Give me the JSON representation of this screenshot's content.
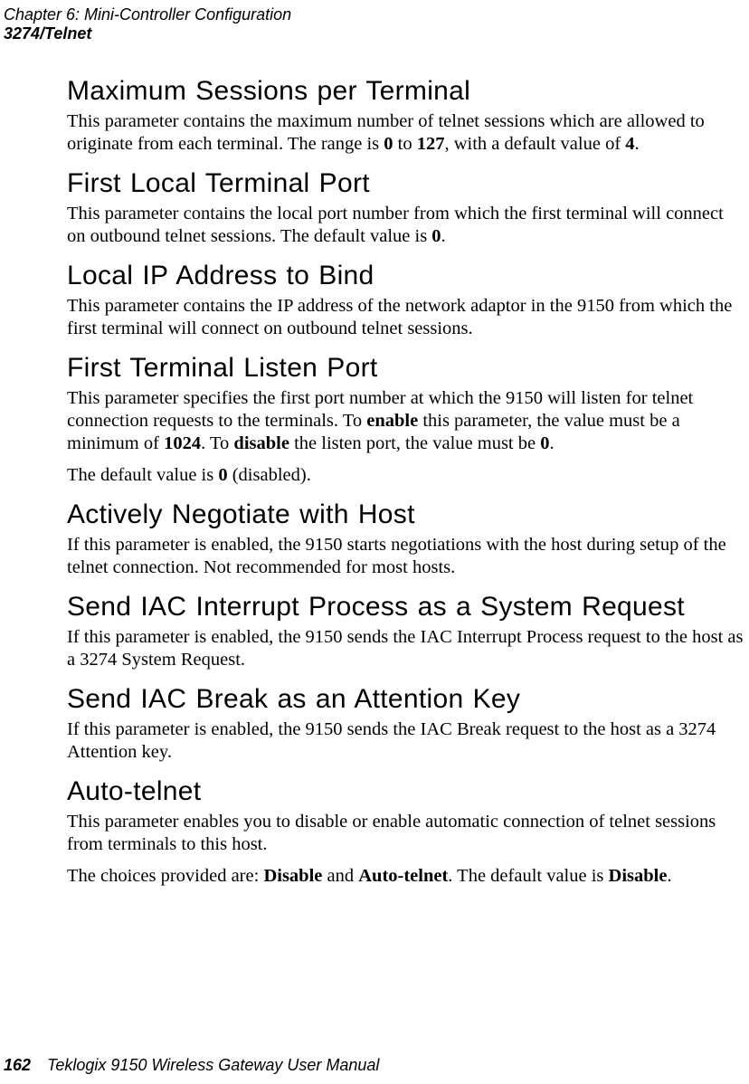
{
  "header": {
    "chapter": "Chapter 6:  Mini-Controller Configuration",
    "section": "3274/Telnet"
  },
  "sections": {
    "s1": {
      "title": "Maximum Sessions per Terminal",
      "p1a": "This parameter contains the maximum number of telnet sessions which are allowed to originate from each terminal. The range is ",
      "p1b": "0",
      "p1c": " to ",
      "p1d": "127",
      "p1e": ", with a default value of ",
      "p1f": "4",
      "p1g": "."
    },
    "s2": {
      "title": "First Local Terminal Port",
      "p1a": "This parameter contains the local port number from which the first terminal will connect on outbound telnet sessions. The default value is ",
      "p1b": "0",
      "p1c": "."
    },
    "s3": {
      "title": "Local IP Address to Bind",
      "p1": "This parameter contains the IP address of the network adaptor in the 9150 from which the first terminal will connect on outbound telnet sessions."
    },
    "s4": {
      "title": "First Terminal Listen Port",
      "p1a": "This parameter specifies the first port number at which the 9150 will listen for telnet connection requests to the terminals. To ",
      "p1b": "enable",
      "p1c": " this parameter, the value must be a minimum of ",
      "p1d": "1024",
      "p1e": ". To ",
      "p1f": "disable",
      "p1g": " the listen port, the value must be ",
      "p1h": "0",
      "p1i": ".",
      "p2a": "The default value is ",
      "p2b": "0",
      "p2c": " (disabled)."
    },
    "s5": {
      "title": "Actively Negotiate with Host",
      "p1": "If this parameter is enabled, the 9150 starts negotiations with the host during setup of the telnet connection. Not recommended for most hosts."
    },
    "s6": {
      "title": "Send IAC Interrupt Process as a System Request",
      "p1": "If this parameter is enabled, the 9150 sends the IAC Interrupt Process request to the host as a 3274 System Request."
    },
    "s7": {
      "title": "Send IAC Break as an Attention Key",
      "p1": "If this parameter is enabled, the 9150 sends the IAC Break request to the host as a 3274 Attention key."
    },
    "s8": {
      "title": "Auto-telnet",
      "p1": "This parameter enables you to disable or enable automatic connection of telnet sessions from terminals to this host.",
      "p2a": "The choices provided are: ",
      "p2b": "Disable",
      "p2c": " and ",
      "p2d": "Auto-telnet",
      "p2e": ". The default value is ",
      "p2f": "Disable",
      "p2g": "."
    }
  },
  "footer": {
    "page": "162",
    "title": "Teklogix 9150 Wireless Gateway User Manual"
  }
}
